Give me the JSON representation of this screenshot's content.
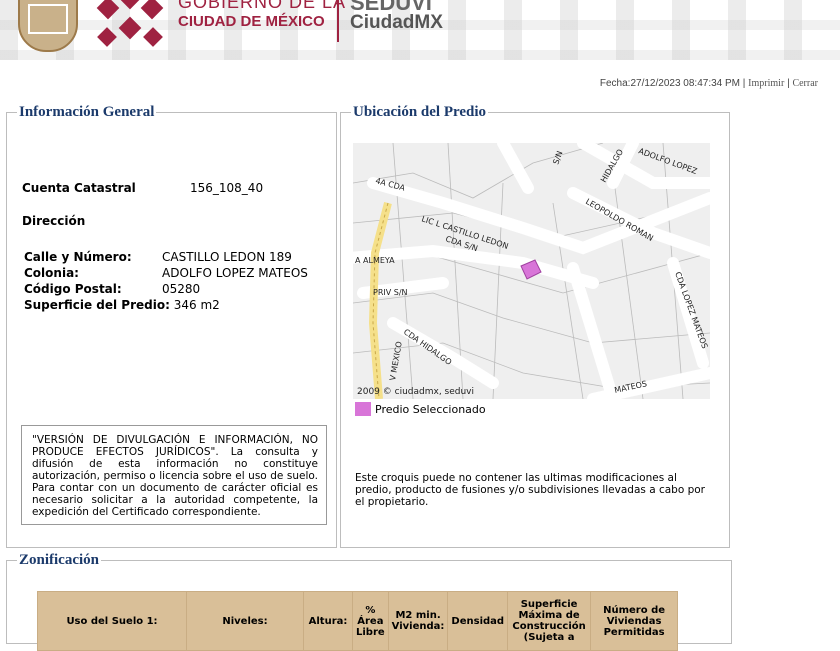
{
  "header": {
    "gov_line1": "GOBIERNO DE LA",
    "gov_line2": "CIUDAD DE MÉXICO",
    "agency_line1": "SEDUVI",
    "agency_line2": "CiudadMX",
    "brand_color": "#9f2241"
  },
  "datebar": {
    "date_text": "Fecha:27/12/2023 08:47:34 PM",
    "print_label": "Imprimir",
    "separator": "|",
    "close_label": "Cerrar"
  },
  "info": {
    "legend": "Información General",
    "cuenta_label": "Cuenta Catastral",
    "cuenta_value": "156_108_40",
    "direccion_label": "Dirección",
    "fields": [
      {
        "label": "Calle y Número:",
        "value": "CASTILLO LEDON 189"
      },
      {
        "label": "Colonia:",
        "value": "ADOLFO LOPEZ MATEOS"
      },
      {
        "label": "Código Postal:",
        "value": "05280"
      },
      {
        "label": "Superficie del Predio:",
        "value": "346 m2"
      }
    ],
    "disclaimer": "\"VERSIÓN DE DIVULGACIÓN E INFORMACIÓN, NO PRODUCE EFECTOS JURÍDICOS\". La consulta y difusión de esta información no constituye autorización, permiso o licencia sobre el uso de suelo. Para contar con un documento de carácter oficial es necesario solicitar a la autoridad competente, la expedición del Certificado correspondiente."
  },
  "location": {
    "legend": "Ubicación del Predio",
    "map_labels": [
      "S/N",
      "HIDALGO",
      "ADOLFO LOPEZ",
      "4A CDA",
      "LEOPOLDO ROMAN",
      "LIC L CASTILLO LEDON",
      "CDA S/N",
      "A ALMEYA",
      "PRIV S/N",
      "CDA LOPEZ MATEOS",
      "V MEXICO",
      "CDA HIDALGO",
      "MATEOS"
    ],
    "map_credit": "2009 © ciudadmx, seduvi",
    "legend_item": "Predio Seleccionado",
    "selected_color": "#d875d8",
    "note": "Este croquis puede no contener las ultimas modificaciones al predio, producto de fusiones y/o subdivisiones llevadas a cabo por el propietario."
  },
  "zonificacion": {
    "legend": "Zonificación",
    "headers": [
      "Uso del Suelo 1:",
      "Niveles:",
      "Altura:",
      "% Área Libre",
      "M2 min. Vivienda:",
      "Densidad",
      "Superficie Máxima de Construcción (Sujeta a",
      "Número de Viviendas Permitidas"
    ],
    "header_color": "#d9bf98"
  }
}
